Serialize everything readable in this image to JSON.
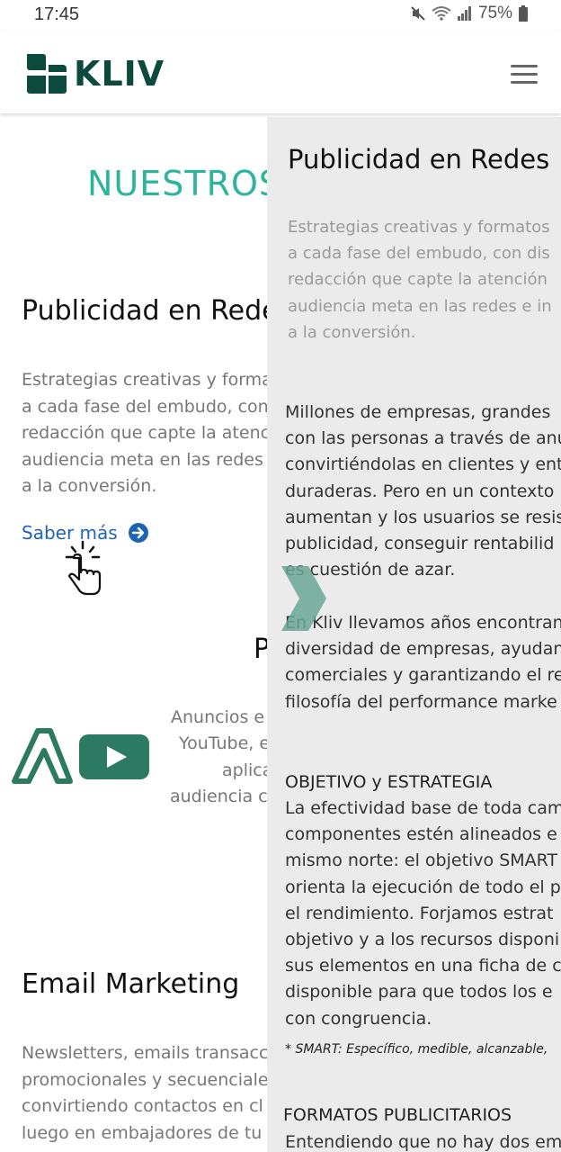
{
  "status_bar": {
    "time": "17:45",
    "battery": "75%"
  },
  "header": {
    "logo_text": "KLIV",
    "brand_color": "#0b4a3d"
  },
  "main": {
    "section_title": "NUESTROS",
    "service1": {
      "title": "Publicidad en Rede",
      "description": "Estrategias creativas y forma\na cada fase del embudo, con\nredacción que capte la atenc\naudiencia meta en las redes\na la conversión.",
      "link": "Saber más"
    },
    "service2": {
      "title_partial": "P",
      "lines": [
        "Anuncios e",
        "YouTube, e",
        "aplica",
        "audiencia c"
      ]
    },
    "service3": {
      "title": "Email Marketing",
      "description": "Newsletters, emails transacc\npromocionales y secuenciale\nconvirtiendo contactos en cl\nluego en embajadores de tu"
    }
  },
  "panel": {
    "title": "Publicidad en Redes",
    "intro": "Estrategias creativas y formatos\na cada fase del embudo, con dis\nredacción que capte la atención\naudiencia meta en las redes e in\na la conversión.",
    "para1": "Millones de empresas, grandes\ncon las personas a través de anu\nconvirtiéndolas en clientes y ent\nduraderas. Pero en un contexto\naumentan y los usuarios se resis\npublicidad, conseguir rentabilid\nes cuestión de azar.",
    "para2": "En Kliv llevamos años encontran\ndiversidad de empresas, ayudan\ncomerciales y garantizando el re\nfilosofía del performance marke",
    "heading1": "OBJETIVO y ESTRATEGIA",
    "para3": "La efectividad base de toda cam\ncomponentes estén alineados e\nmismo norte: el objetivo SMART\norienta la ejecución de todo el p\nel rendimiento. Forjamos estrat\nobjetivo y a los recursos disponi\nsus elementos en una ficha de c\ndisponible para que todos los e\ncon congruencia.",
    "footnote": "* SMART: Específico, medible, alcanzable,",
    "heading2": "FORMATOS PUBLICITARIOS",
    "para4": "Entendiendo que no hay dos em"
  },
  "colors": {
    "accent": "#2db59c",
    "link": "#1e64b4",
    "panel_bg": "#ebebeb",
    "chevron": "#6aa896"
  }
}
